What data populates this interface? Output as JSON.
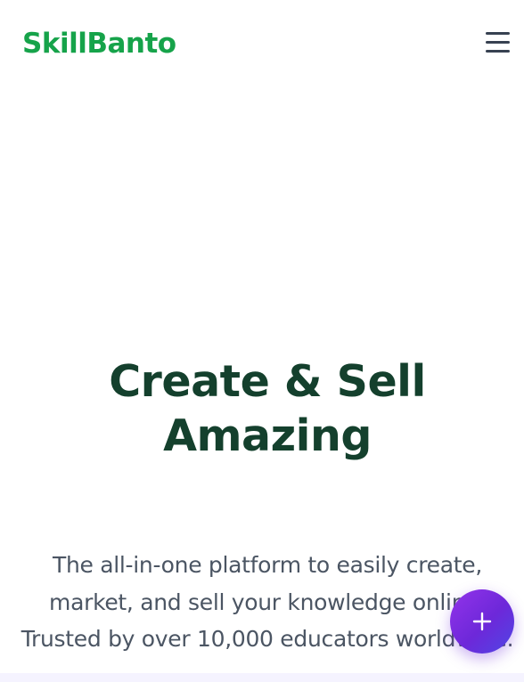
{
  "header": {
    "logo_text": "SkillBanto",
    "menu_icon": "hamburger-menu-icon"
  },
  "hero": {
    "title_line1": "Create & Sell",
    "title_line2": "Amazing",
    "subtitle": "The all-in-one platform to easily create, market, and sell your knowledge online. Trusted by over 10,000 educators worldwide."
  },
  "fab": {
    "icon": "plus-icon"
  },
  "colors": {
    "brand_green": "#16a34a",
    "title_dark_green": "#14402d",
    "body_gray": "#4b5563",
    "fab_purple": "#7c3aed"
  }
}
